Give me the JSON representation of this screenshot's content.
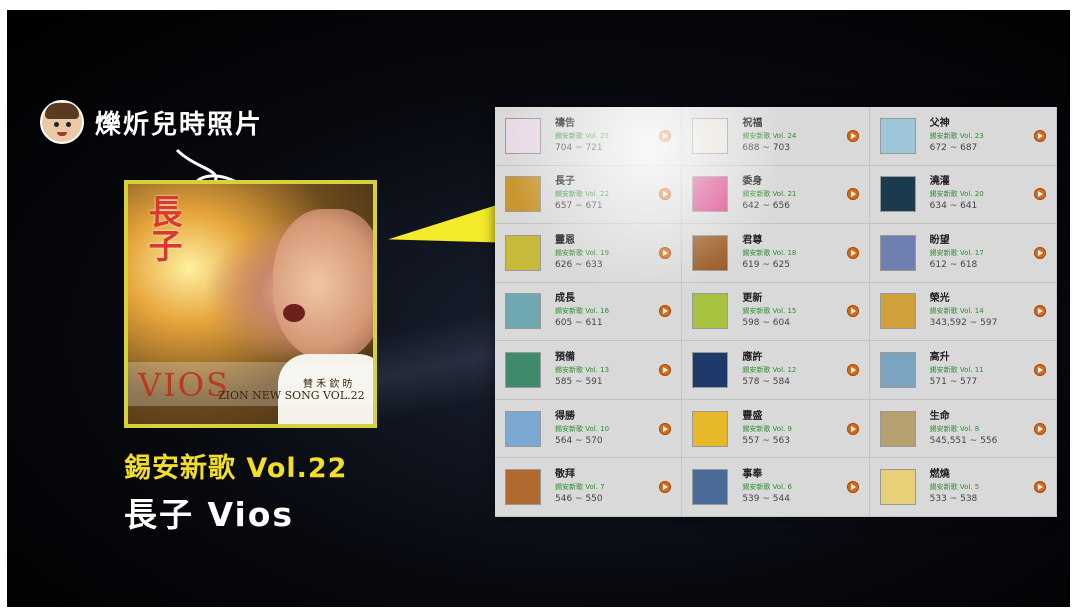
{
  "caption": {
    "text": "爍炘兒時照片"
  },
  "cover": {
    "vertical_title": "長子",
    "vios": "VIOS",
    "zion": "ZION NEW SONG VOL.22",
    "small_chinese": "賛 禾 欽 昉"
  },
  "titles": {
    "line1": "錫安新歌 Vol.22",
    "line2": "長子 Vios"
  },
  "colors": {
    "accent_yellow": "#f2dd2b",
    "pointer_yellow": "#f4eb2a",
    "play_orange": "#d66a1e",
    "volume_green": "#2f8a2f"
  },
  "albums": [
    {
      "name": "禱告",
      "volume": "錫安新歌 Vol. 25",
      "range": "704 ~ 721",
      "thumb": "#e8d8e4"
    },
    {
      "name": "祝福",
      "volume": "錫安新歌 Vol. 24",
      "range": "688 ~ 703",
      "thumb": "#e6e0d8"
    },
    {
      "name": "父神",
      "volume": "錫安新歌 Vol. 23",
      "range": "672 ~ 687",
      "thumb": "#9ec6d8"
    },
    {
      "name": "長子",
      "volume": "錫安新歌 Vol. 22",
      "range": "657 ~ 671",
      "thumb": "#c9952e"
    },
    {
      "name": "委身",
      "volume": "錫安新歌 Vol. 21",
      "range": "642 ~ 656",
      "thumb": "#d74a8c"
    },
    {
      "name": "澆灌",
      "volume": "錫安新歌 Vol. 20",
      "range": "634 ~ 641",
      "thumb": "#1c3a4e"
    },
    {
      "name": "靈恩",
      "volume": "錫安新歌 Vol. 19",
      "range": "626 ~ 633",
      "thumb": "#c7b93a"
    },
    {
      "name": "君尊",
      "volume": "錫安新歌 Vol. 18",
      "range": "619 ~ 625",
      "thumb": "#9a5a24"
    },
    {
      "name": "盼望",
      "volume": "錫安新歌 Vol. 17",
      "range": "612 ~ 618",
      "thumb": "#6f7fb0"
    },
    {
      "name": "成長",
      "volume": "錫安新歌 Vol. 16",
      "range": "605 ~ 611",
      "thumb": "#6fa8b0"
    },
    {
      "name": "更新",
      "volume": "錫安新歌 Vol. 15",
      "range": "598 ~ 604",
      "thumb": "#a7c23e"
    },
    {
      "name": "榮光",
      "volume": "錫安新歌 Vol. 14",
      "range": "343,592 ~ 597",
      "thumb": "#d0a03a"
    },
    {
      "name": "預備",
      "volume": "錫安新歌 Vol. 13",
      "range": "585 ~ 591",
      "thumb": "#3f8a6a"
    },
    {
      "name": "應許",
      "volume": "錫安新歌 Vol. 12",
      "range": "578 ~ 584",
      "thumb": "#1d3a6a"
    },
    {
      "name": "高升",
      "volume": "錫安新歌 Vol. 11",
      "range": "571 ~ 577",
      "thumb": "#7aa4c0"
    },
    {
      "name": "得勝",
      "volume": "錫安新歌 Vol. 10",
      "range": "564 ~ 570",
      "thumb": "#7aa8d0"
    },
    {
      "name": "豐盛",
      "volume": "錫安新歌 Vol. 9",
      "range": "557 ~ 563",
      "thumb": "#e6b82a"
    },
    {
      "name": "生命",
      "volume": "錫安新歌 Vol. 8",
      "range": "545,551 ~ 556",
      "thumb": "#b7a070"
    },
    {
      "name": "敬拜",
      "volume": "錫安新歌 Vol. 7",
      "range": "546 ~ 550",
      "thumb": "#b06a30"
    },
    {
      "name": "事奉",
      "volume": "錫安新歌 Vol. 6",
      "range": "539 ~ 544",
      "thumb": "#4a6a98"
    },
    {
      "name": "燃燒",
      "volume": "錫安新歌 Vol. 5",
      "range": "533 ~ 538",
      "thumb": "#e8d078"
    }
  ]
}
